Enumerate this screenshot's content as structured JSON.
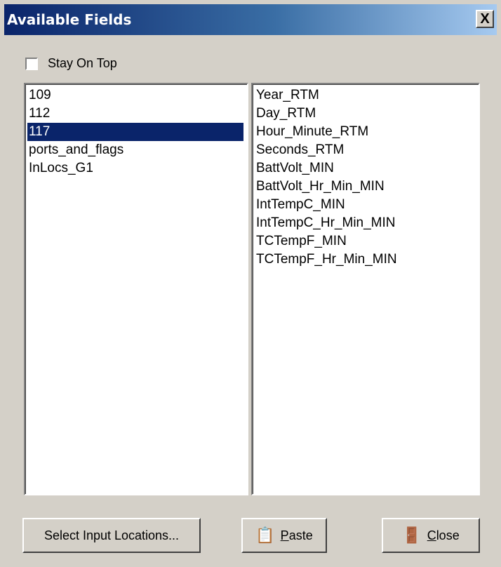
{
  "window": {
    "title": "Available Fields",
    "close_label": "X"
  },
  "stay_on_top": {
    "label": "Stay On Top",
    "checked": false
  },
  "tables": {
    "items": [
      "109",
      "112",
      "117",
      "ports_and_flags",
      "InLocs_G1"
    ],
    "selected_index": 2
  },
  "fields": {
    "items": [
      "Year_RTM",
      "Day_RTM",
      "Hour_Minute_RTM",
      "Seconds_RTM",
      "BattVolt_MIN",
      "BattVolt_Hr_Min_MIN",
      "IntTempC_MIN",
      "IntTempC_Hr_Min_MIN",
      "TCTempF_MIN",
      "TCTempF_Hr_Min_MIN"
    ]
  },
  "buttons": {
    "select_input_locations": "Select Input Locations...",
    "paste_first": "P",
    "paste_rest": "aste",
    "paste_icon": "paste-icon",
    "close_first": "C",
    "close_rest": "lose",
    "close_icon": "door-exit-icon"
  }
}
